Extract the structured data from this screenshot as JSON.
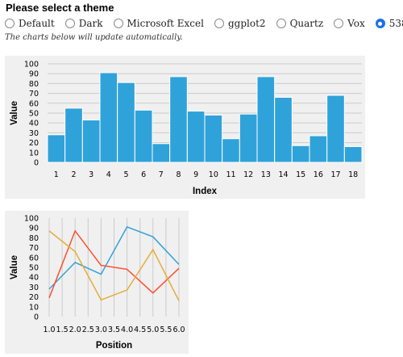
{
  "page": {
    "heading": "Please select a theme",
    "note": "The charts below will update automatically.",
    "themes": [
      {
        "label": "Default",
        "checked": false
      },
      {
        "label": "Dark",
        "checked": false
      },
      {
        "label": "Microsoft Excel",
        "checked": false
      },
      {
        "label": "ggplot2",
        "checked": false
      },
      {
        "label": "Quartz",
        "checked": false
      },
      {
        "label": "Vox",
        "checked": false
      },
      {
        "label": "538",
        "checked": true
      }
    ]
  },
  "colors": {
    "panel": "#f0f0f0",
    "grid": "#cbcbcb",
    "bar": "#30a2da",
    "bar_stroke": "#ffffff",
    "series": [
      "#30a2da",
      "#fc4f30",
      "#e5ae38"
    ]
  },
  "chart_data": [
    {
      "type": "bar",
      "xlabel": "Index",
      "ylabel": "Value",
      "categories": [
        "1",
        "2",
        "3",
        "4",
        "5",
        "6",
        "7",
        "8",
        "9",
        "10",
        "11",
        "12",
        "13",
        "14",
        "15",
        "16",
        "17",
        "18"
      ],
      "values": [
        28,
        55,
        43,
        91,
        81,
        53,
        19,
        87,
        52,
        48,
        24,
        49,
        87,
        66,
        17,
        27,
        68,
        16
      ],
      "ylim": [
        0,
        100
      ],
      "yticks": [
        0,
        10,
        20,
        30,
        40,
        50,
        60,
        70,
        80,
        90,
        100
      ],
      "grid": "horizontal"
    },
    {
      "type": "line",
      "xlabel": "Position",
      "ylabel": "Value",
      "x": [
        1,
        2,
        3,
        4,
        5,
        6
      ],
      "series": [
        {
          "values": [
            28,
            55,
            43,
            91,
            81,
            53
          ]
        },
        {
          "values": [
            19,
            87,
            52,
            48,
            24,
            49
          ]
        },
        {
          "values": [
            87,
            66,
            17,
            27,
            68,
            16
          ]
        }
      ],
      "xlim": [
        1,
        6
      ],
      "ylim": [
        0,
        100
      ],
      "xticks": [
        "1.0",
        "1.5",
        "2.0",
        "2.5",
        "3.0",
        "3.5",
        "4.0",
        "4.5",
        "5.0",
        "5.5",
        "6.0"
      ],
      "yticks": [
        0,
        10,
        20,
        30,
        40,
        50,
        60,
        70,
        80,
        90,
        100
      ],
      "grid": "vertical"
    }
  ]
}
